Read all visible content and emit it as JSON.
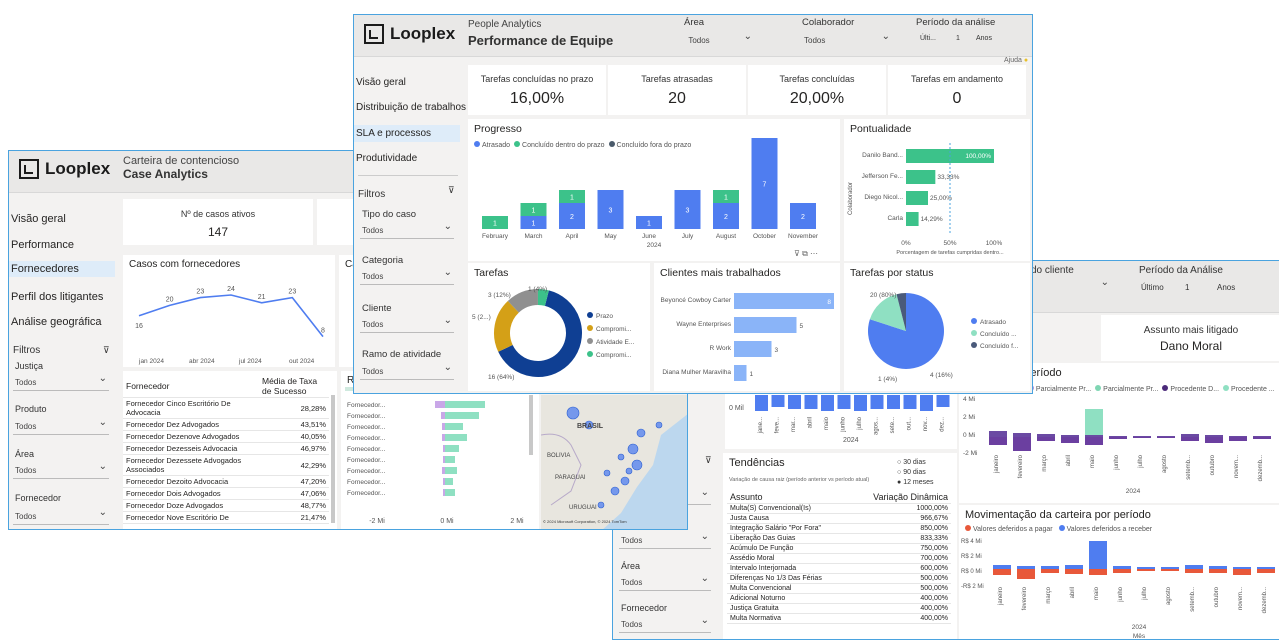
{
  "colors": {
    "blue": "#4f7df0",
    "green": "#3cc28a",
    "mint": "#8fe0c2",
    "purple": "#6b3fa0",
    "orange": "#e8583a",
    "gold": "#d4a017",
    "gray": "#909090",
    "navy": "#0f3f93",
    "accent": "#4aa3df"
  },
  "case": {
    "logo": "Looplex",
    "subtitle": "Carteira de contencioso",
    "title": "Case Analytics",
    "nav": [
      "Visão geral",
      "Performance",
      "Fornecedores",
      "Perfil dos litigantes",
      "Análise geográfica"
    ],
    "filters_label": "Filtros",
    "filters": [
      {
        "label": "Justiça",
        "value": "Todos"
      },
      {
        "label": "Produto",
        "value": "Todos"
      },
      {
        "label": "Área",
        "value": "Todos"
      },
      {
        "label": "Fornecedor",
        "value": "Todos"
      }
    ],
    "kpi_label": "Nº de casos ativos",
    "kpi_value": "147",
    "casos_title": "Casos com fornecedores",
    "casos_second_title_fragment": "Ca",
    "line_x_labels": [
      "jan 2024",
      "abr 2024",
      "jul 2024",
      "out 2024"
    ],
    "line_values": [
      16,
      20,
      23,
      24,
      21,
      23,
      8
    ],
    "table_head": [
      "Fornecedor",
      "Média de Taxa de Sucesso"
    ],
    "table_rows": [
      [
        "Fornecedor Cinco Escritório De Advocacia",
        "28,28%"
      ],
      [
        "Fornecedor Dez Advogados",
        "43,51%"
      ],
      [
        "Fornecedor Dezenove Advogados",
        "40,05%"
      ],
      [
        "Fornecedor Dezesseis Advocacia",
        "46,97%"
      ],
      [
        "Fornecedor Dezessete Advogados Associados",
        "42,29%"
      ],
      [
        "Fornecedor Dezoito Advocacia",
        "47,20%"
      ],
      [
        "Fornecedor Dois Advogados",
        "47,06%"
      ],
      [
        "Fornecedor Doze Advogados",
        "48,77%"
      ],
      [
        "Fornecedor Nove Escritório De",
        "21,47%"
      ]
    ],
    "re_title": "Re",
    "re_rows": [
      "Fornecedor...",
      "Fornecedor...",
      "Fornecedor...",
      "Fornecedor...",
      "Fornecedor...",
      "Fornecedor...",
      "Fornecedor...",
      "Fornecedor...",
      "Fornecedor..."
    ],
    "re_axis": [
      "-2 Mi",
      "0 Mi",
      "2 Mi"
    ],
    "map_labels": [
      "BRASIL",
      "BOLIVIA",
      "PARAGUAI",
      "URUGUAI"
    ],
    "map_credit": "© 2024 Microsoft Corporation, © 2024 TomTom"
  },
  "perf": {
    "logo": "Looplex",
    "subtitle": "People Analytics",
    "title": "Performance de Equipe",
    "slicers": [
      {
        "label": "Área",
        "value": "Todos"
      },
      {
        "label": "Colaborador",
        "value": "Todos"
      },
      {
        "label": "Período da análise",
        "value": "Últi...",
        "n": "1",
        "unit": "Anos"
      }
    ],
    "help": "Ajuda",
    "nav": [
      "Visão geral",
      "Distribuição de trabalhos",
      "SLA e processos",
      "Produtividade"
    ],
    "filters_label": "Filtros",
    "filters": [
      {
        "label": "Tipo do caso",
        "value": "Todos"
      },
      {
        "label": "Categoria",
        "value": "Todos"
      },
      {
        "label": "Cliente",
        "value": "Todos"
      },
      {
        "label": "Ramo de atividade",
        "value": "Todos"
      }
    ],
    "kpis": [
      {
        "label": "Tarefas concluídas no prazo",
        "value": "16,00%"
      },
      {
        "label": "Tarefas atrasadas",
        "value": "20"
      },
      {
        "label": "Tarefas concluídas",
        "value": "20,00%"
      },
      {
        "label": "Tarefas em andamento",
        "value": "0"
      }
    ],
    "progresso_title": "Progresso",
    "progresso_legend": [
      "Atrasado",
      "Concluído dentro do prazo",
      "Concluído fora do prazo"
    ],
    "progresso_months": [
      "February",
      "March",
      "April",
      "May",
      "June",
      "July",
      "August",
      "October",
      "November"
    ],
    "progresso_year": "2024",
    "progresso_blue": [
      0,
      1,
      2,
      3,
      1,
      3,
      2,
      7,
      2
    ],
    "progresso_green": [
      1,
      1,
      1,
      0,
      0,
      0,
      1,
      0,
      0
    ],
    "pontualidade_title": "Pontualidade",
    "pontualidade_ylabel": "Colaborador",
    "pontualidade_xlabel": "Porcentagem de tarefas cumpridas dentro...",
    "pontualidade_axis": [
      "0%",
      "50%",
      "100%"
    ],
    "pontualidade": [
      {
        "name": "Danilo Band...",
        "value": 100,
        "label": "100,00%"
      },
      {
        "name": "Jefferson Fe...",
        "value": 33.33,
        "label": "33,33%"
      },
      {
        "name": "Diego Nicol...",
        "value": 25,
        "label": "25,00%"
      },
      {
        "name": "Carla",
        "value": 14.29,
        "label": "14,29%"
      }
    ],
    "tarefas_title": "Tarefas",
    "tarefas_legend": [
      "Prazo",
      "Compromi...",
      "Atividade E...",
      "Compromi..."
    ],
    "tarefas_labels": [
      "3 (12%)",
      "1 (4%)",
      "5 (2...)",
      "16 (64%)"
    ],
    "clientes_title": "Clientes mais trabalhados",
    "clientes": [
      {
        "name": "Beyoncé Cowboy Carter",
        "value": 8
      },
      {
        "name": "Wayne Enterprises",
        "value": 5
      },
      {
        "name": "R Work",
        "value": 3
      },
      {
        "name": "Diana Mulher Maravilha",
        "value": 1
      }
    ],
    "status_title": "Tarefas por status",
    "status_legend": [
      "Atrasado",
      "Concluído ...",
      "Concluído f..."
    ],
    "status_labels": [
      "20 (80%)",
      "1 (4%)",
      "4 (16%)"
    ]
  },
  "lit": {
    "slicer1": "do cliente",
    "slicer2": "Período da Análise",
    "slicer2_vals": [
      "Último",
      "1",
      "Anos"
    ],
    "assunto_label": "Assunto mais litigado",
    "assunto_value": "Dano Moral",
    "hist_months": [
      "jane...",
      "feve...",
      "mar...",
      "abril",
      "maio",
      "junho",
      "julho",
      "agos...",
      "sete...",
      "out...",
      "nov...",
      "dez..."
    ],
    "hist_axis": "0 Mil",
    "hist_year": "2024",
    "filter_area": "Área",
    "filter_fornecedor": "Fornecedor",
    "todos": "Todos",
    "tend_title": "Tendências",
    "tend_sub": "Variação de causa raiz (período anterior vs período atual)",
    "tend_opts": [
      "30 dias",
      "90 dias",
      "12 meses"
    ],
    "tend_head": [
      "Assunto",
      "Variação Dinâmica"
    ],
    "tend_rows": [
      [
        "Multa(S) Convencional(Is)",
        "1000,00%"
      ],
      [
        "Justa Causa",
        "966,67%"
      ],
      [
        "Integração Salário \"Por Fora\"",
        "850,00%"
      ],
      [
        "Liberação Das Guias",
        "833,33%"
      ],
      [
        "Acúmulo De Função",
        "750,00%"
      ],
      [
        "Assédio Moral",
        "700,00%"
      ],
      [
        "Intervalo Interjornada",
        "600,00%"
      ],
      [
        "Diferenças No 1/3 Das Férias",
        "500,00%"
      ],
      [
        "Multa Convencional",
        "500,00%"
      ],
      [
        "Adicional Noturno",
        "400,00%"
      ],
      [
        "Justiça Gratuita",
        "400,00%"
      ],
      [
        "Multa Normativa",
        "400,00%"
      ]
    ],
    "dec_title": "ecisões por período",
    "dec_legend": [
      "procedente Vi...",
      "Parcialmente Pr...",
      "Parcialmente Pr...",
      "Procedente D...",
      "Procedente ..."
    ],
    "dec_axis": [
      "4 Mi",
      "2 Mi",
      "0 Mi",
      "-2 Mi"
    ],
    "dec_months": [
      "janeiro",
      "fevereiro",
      "março",
      "abril",
      "maio",
      "junho",
      "julho",
      "agosto",
      "setemb...",
      "outubro",
      "novem...",
      "dezemb..."
    ],
    "dec_year": "2024",
    "mov_title": "Movimentação da carteira por período",
    "mov_legend": [
      "Valores deferidos a pagar",
      "Valores deferidos a receber"
    ],
    "mov_axis": [
      "R$ 4 Mi",
      "R$ 2 Mi",
      "R$ 0 Mi",
      "-R$ 2 Mi"
    ],
    "mov_months": [
      "janeiro",
      "fevereiro",
      "março",
      "abril",
      "maio",
      "junho",
      "julho",
      "agosto",
      "setemb...",
      "outubro",
      "novem...",
      "dezemb..."
    ],
    "mov_year": "2024",
    "mov_xlabel": "Mês"
  }
}
